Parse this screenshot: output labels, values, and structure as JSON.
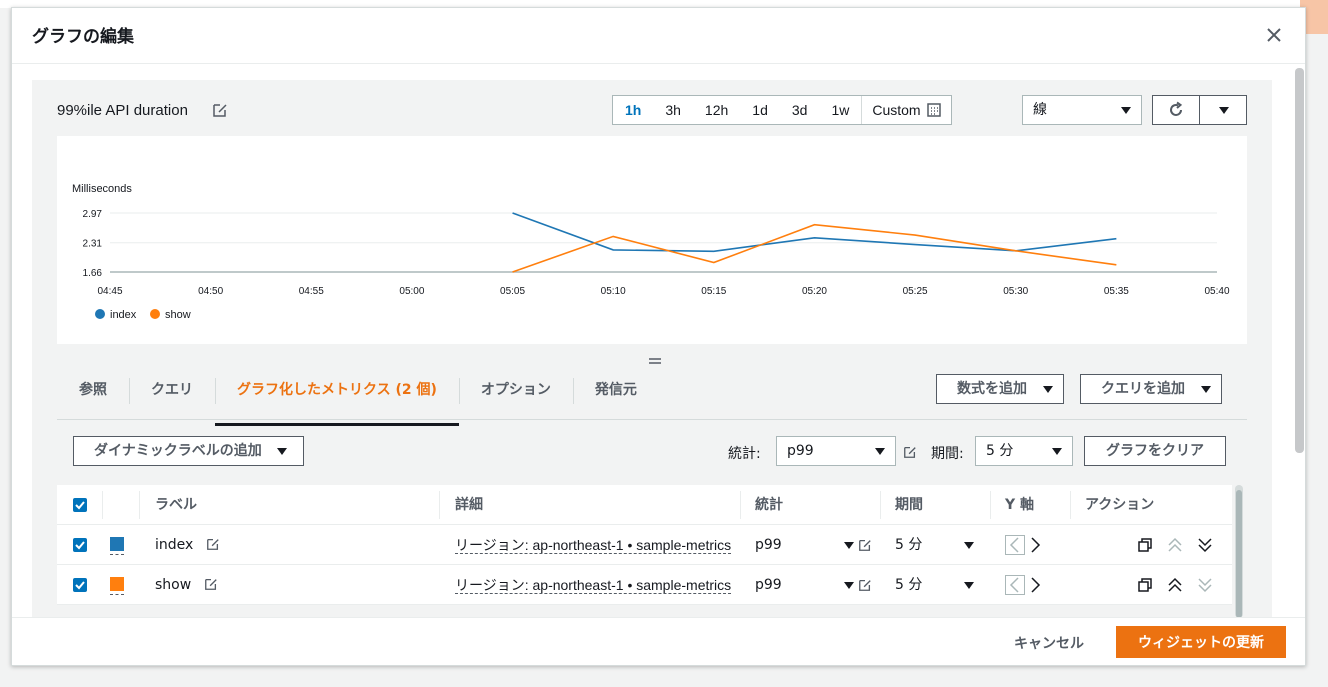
{
  "modal": {
    "title": "グラフの編集"
  },
  "graph": {
    "title": "99%ile API duration",
    "time_ranges": [
      "1h",
      "3h",
      "12h",
      "1d",
      "3d",
      "1w"
    ],
    "active_range": "1h",
    "custom_label": "Custom",
    "chart_type": "線"
  },
  "chart_data": {
    "type": "line",
    "ylabel": "Milliseconds",
    "yticks": [
      "2.97",
      "2.31",
      "1.66"
    ],
    "ylim": [
      1.66,
      2.97
    ],
    "x_ticks": [
      "04:45",
      "04:50",
      "04:55",
      "05:00",
      "05:05",
      "05:10",
      "05:15",
      "05:20",
      "05:25",
      "05:30",
      "05:35",
      "05:40"
    ],
    "series": [
      {
        "name": "index",
        "color": "#1f77b4",
        "points": [
          [
            "05:05",
            2.97
          ],
          [
            "05:10",
            2.15
          ],
          [
            "05:15",
            2.12
          ],
          [
            "05:20",
            2.42
          ],
          [
            "05:25",
            2.27
          ],
          [
            "05:30",
            2.13
          ],
          [
            "05:35",
            2.4
          ]
        ]
      },
      {
        "name": "show",
        "color": "#ff7f0e",
        "points": [
          [
            "05:05",
            1.66
          ],
          [
            "05:10",
            2.45
          ],
          [
            "05:15",
            1.87
          ],
          [
            "05:20",
            2.71
          ],
          [
            "05:25",
            2.48
          ],
          [
            "05:30",
            2.13
          ],
          [
            "05:35",
            1.82
          ]
        ]
      }
    ],
    "grid": true,
    "legend_position": "bottom-left"
  },
  "tabs": [
    {
      "label": "参照"
    },
    {
      "label": "クエリ"
    },
    {
      "label": "グラフ化したメトリクス (2 個)"
    },
    {
      "label": "オプション"
    },
    {
      "label": "発信元"
    }
  ],
  "tab_actions": {
    "add_math": "数式を追加",
    "add_query": "クエリを追加"
  },
  "toolbar": {
    "dynamic_label": "ダイナミックラベルの追加",
    "stat_label": "統計:",
    "stat_value": "p99",
    "period_label": "期間:",
    "period_value": "5 分",
    "clear_graph": "グラフをクリア"
  },
  "table": {
    "headers": {
      "label": "ラベル",
      "details": "詳細",
      "stat": "統計",
      "period": "期間",
      "yaxis": "Y 軸",
      "actions": "アクション"
    },
    "rows": [
      {
        "label": "index",
        "color": "#1f77b4",
        "details": "リージョン: ap-northeast-1 • sample-metrics",
        "stat": "p99",
        "period": "5 分"
      },
      {
        "label": "show",
        "color": "#ff7f0e",
        "details": "リージョン: ap-northeast-1 • sample-metrics",
        "stat": "p99",
        "period": "5 分"
      }
    ]
  },
  "footer": {
    "cancel": "キャンセル",
    "update": "ウィジェットの更新"
  }
}
